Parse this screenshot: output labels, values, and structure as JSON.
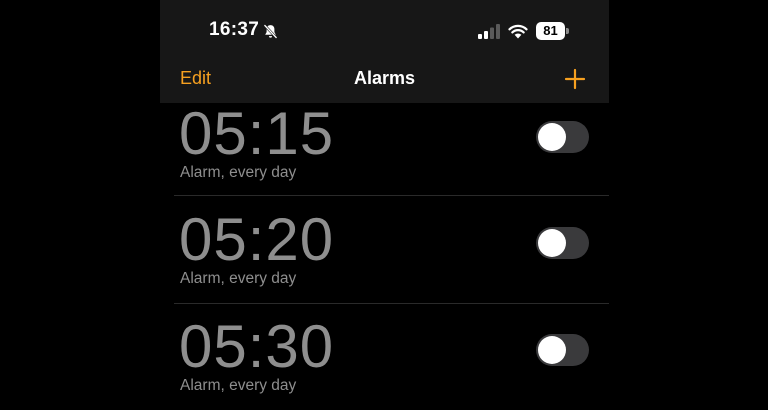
{
  "status_bar": {
    "time": "16:37",
    "silent_icon": "bell-slash-icon",
    "cellular_icon": "cellular-signal-icon",
    "wifi_icon": "wifi-icon",
    "battery_level": "81"
  },
  "nav": {
    "edit_label": "Edit",
    "title": "Alarms",
    "add_icon": "plus-icon",
    "accent_color": "#f6a020"
  },
  "alarms": [
    {
      "time": "05:15",
      "label": "Alarm, every day",
      "enabled": false
    },
    {
      "time": "05:20",
      "label": "Alarm, every day",
      "enabled": false
    },
    {
      "time": "05:30",
      "label": "Alarm, every day",
      "enabled": false
    }
  ]
}
